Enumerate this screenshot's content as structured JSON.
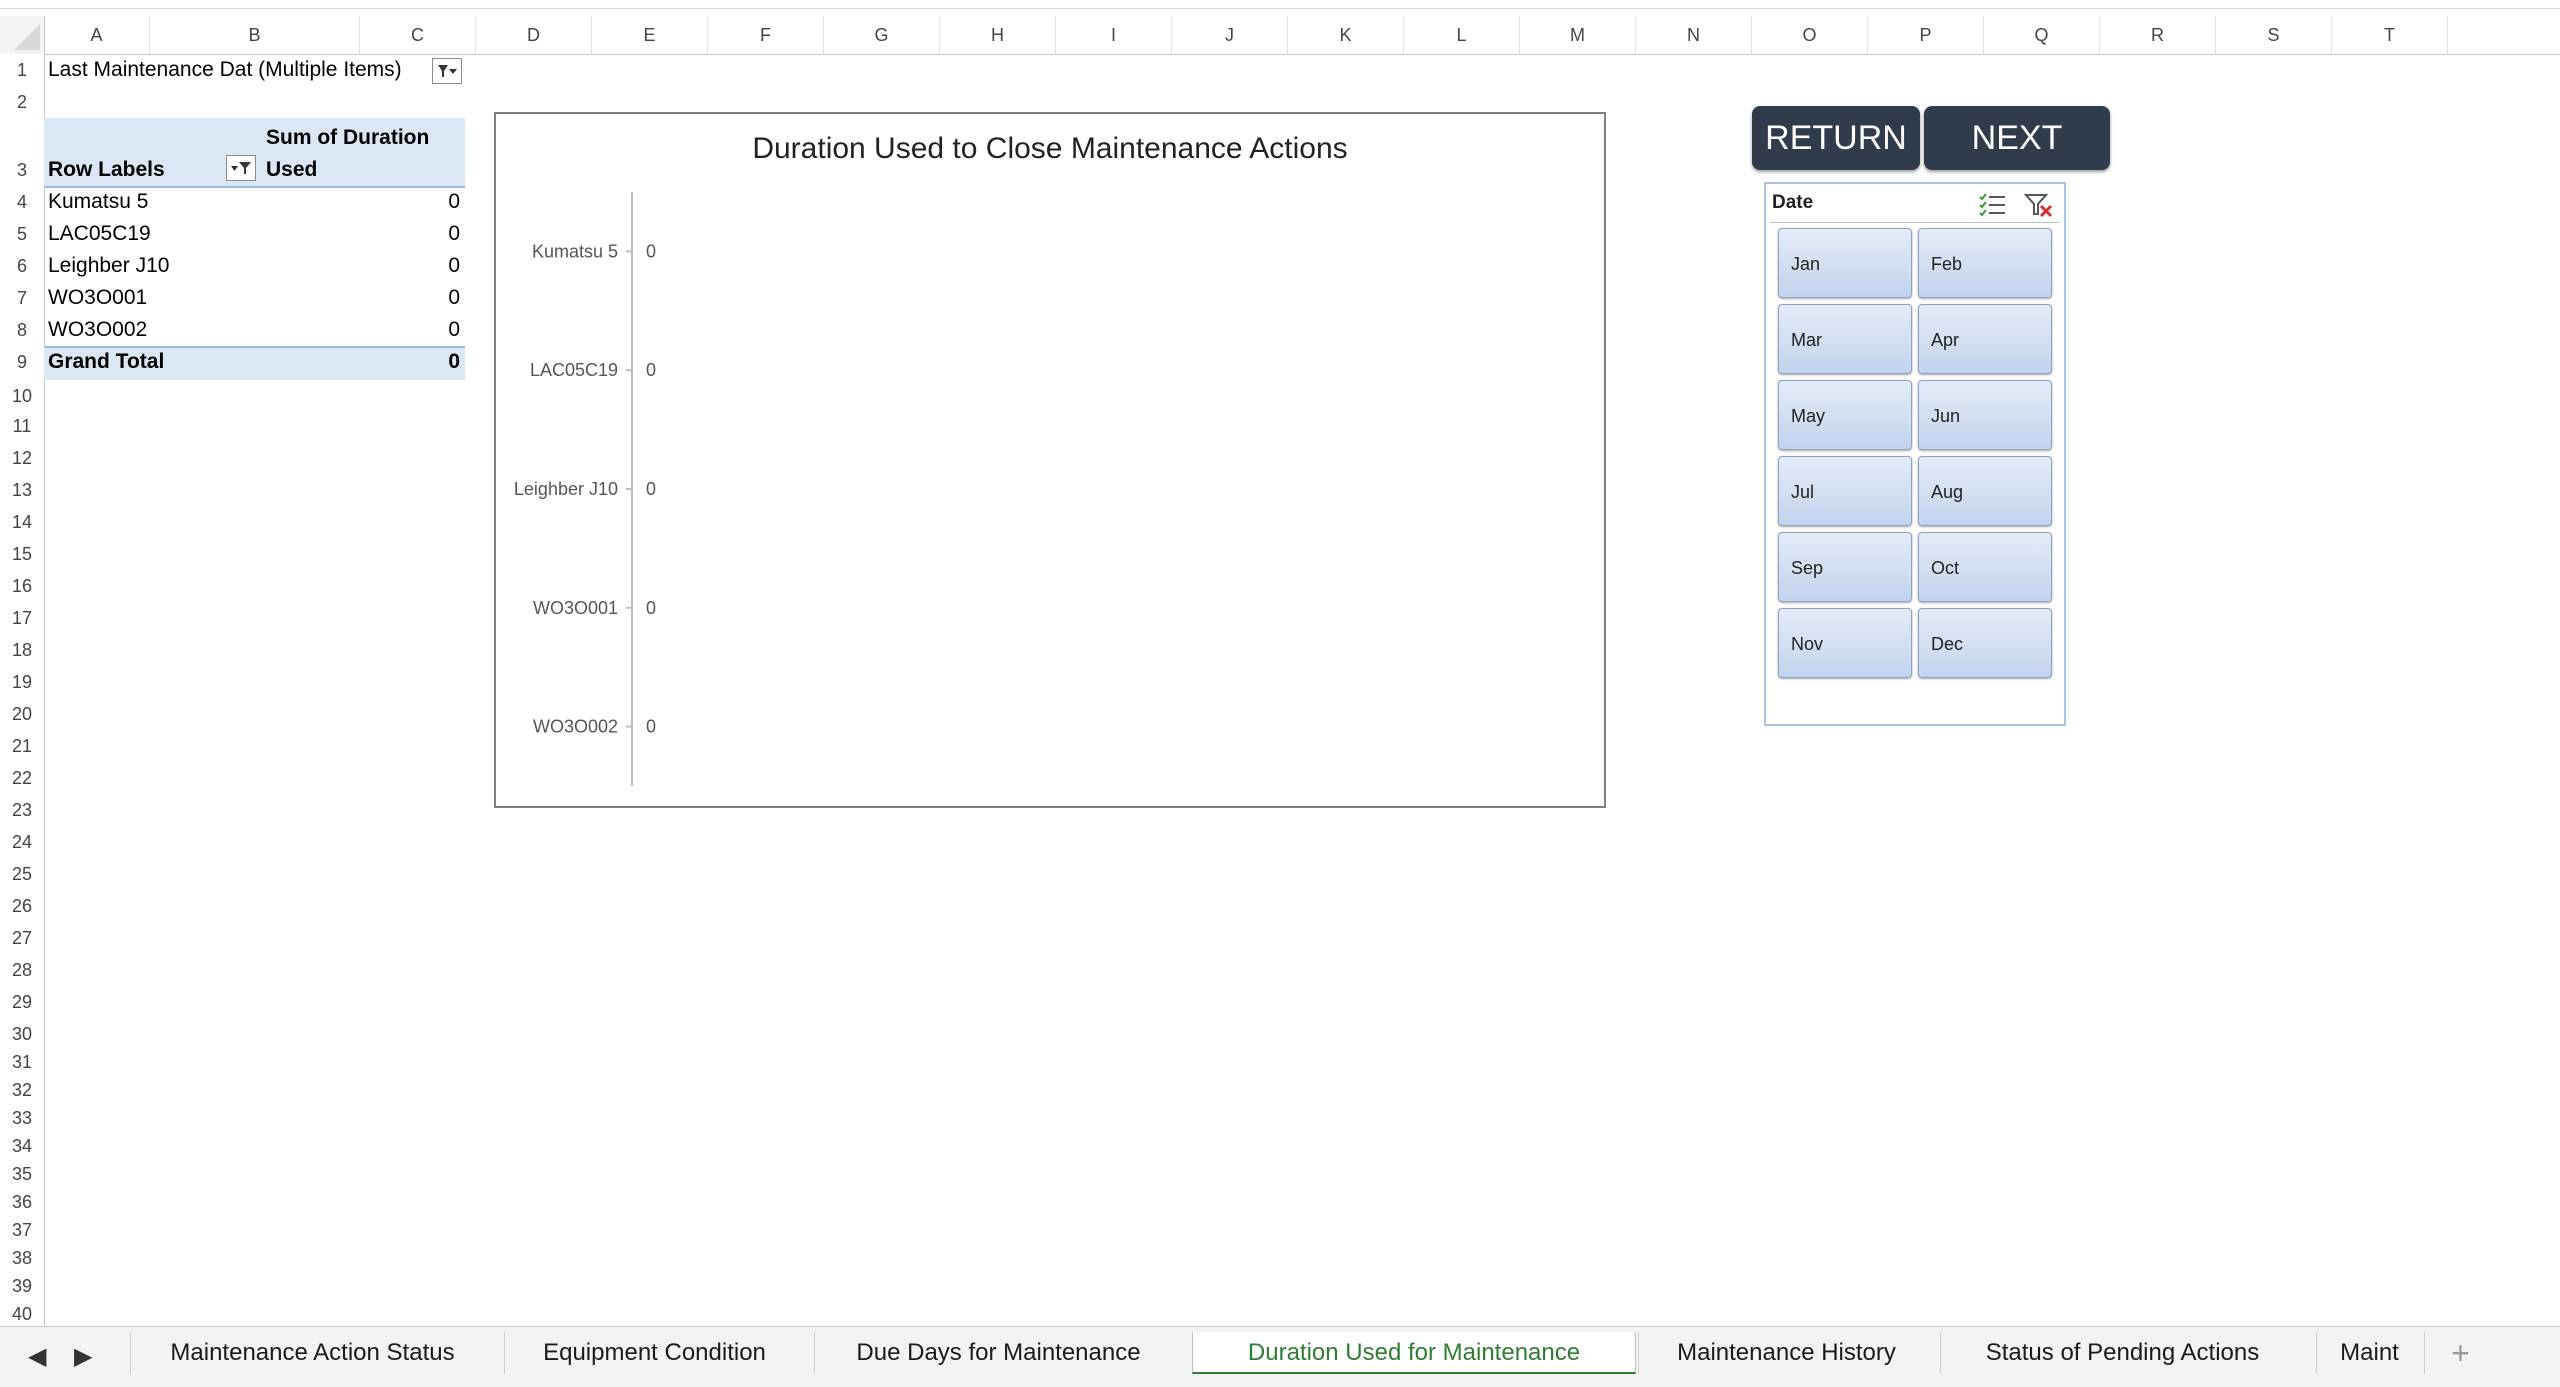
{
  "columns": [
    "A",
    "B",
    "C",
    "D",
    "E",
    "F",
    "G",
    "H",
    "I",
    "J",
    "K",
    "L",
    "M",
    "N",
    "O",
    "P",
    "Q",
    "R",
    "S",
    "T"
  ],
  "rows": [
    "1",
    "2",
    "3",
    "4",
    "5",
    "6",
    "7",
    "8",
    "9",
    "10",
    "11",
    "12",
    "13",
    "14",
    "15",
    "16",
    "17",
    "18",
    "19",
    "20",
    "21",
    "22",
    "23",
    "24",
    "25",
    "26",
    "27",
    "28",
    "29",
    "30",
    "31",
    "32",
    "33",
    "34",
    "35",
    "36",
    "37",
    "38",
    "39",
    "40"
  ],
  "pivot": {
    "filter_label": "Last Maintenance Dat (Multiple Items)",
    "row_labels_header": "Row Labels",
    "sum_header_line1": "Sum of Duration",
    "sum_header_line2": "Used",
    "items": [
      {
        "label": "Kumatsu 5",
        "value": "0"
      },
      {
        "label": "LAC05C19",
        "value": "0"
      },
      {
        "label": "Leighber J10",
        "value": "0"
      },
      {
        "label": "WO3O001",
        "value": "0"
      },
      {
        "label": "WO3O002",
        "value": "0"
      }
    ],
    "grand_total_label": "Grand Total",
    "grand_total_value": "0"
  },
  "chart_data": {
    "type": "bar",
    "title": "Duration Used to Close Maintenance Actions",
    "categories": [
      "Kumatsu 5",
      "LAC05C19",
      "Leighber J10",
      "WO3O001",
      "WO3O002"
    ],
    "values": [
      0,
      0,
      0,
      0,
      0
    ],
    "data_labels": [
      "0",
      "0",
      "0",
      "0",
      "0"
    ],
    "orientation": "horizontal"
  },
  "buttons": {
    "return_label": "RETURN",
    "next_label": "NEXT"
  },
  "slicer": {
    "title": "Date",
    "items": [
      "Jan",
      "Feb",
      "Mar",
      "Apr",
      "May",
      "Jun",
      "Jul",
      "Aug",
      "Sep",
      "Oct",
      "Nov",
      "Dec"
    ]
  },
  "sheet_tabs": [
    {
      "label": "Maintenance Action Status",
      "active": false
    },
    {
      "label": "Equipment Condition",
      "active": false
    },
    {
      "label": "Due Days for Maintenance",
      "active": false
    },
    {
      "label": "Duration Used for Maintenance",
      "active": true
    },
    {
      "label": "Maintenance History",
      "active": false
    },
    {
      "label": "Status of Pending Actions",
      "active": false
    },
    {
      "label": "Maint",
      "active": false
    }
  ],
  "add_sheet_label": "+",
  "colors": {
    "active_tab_text": "#2e7d32",
    "button_bg": "#303b4b",
    "pivot_header_bg": "#dbe7f5"
  }
}
